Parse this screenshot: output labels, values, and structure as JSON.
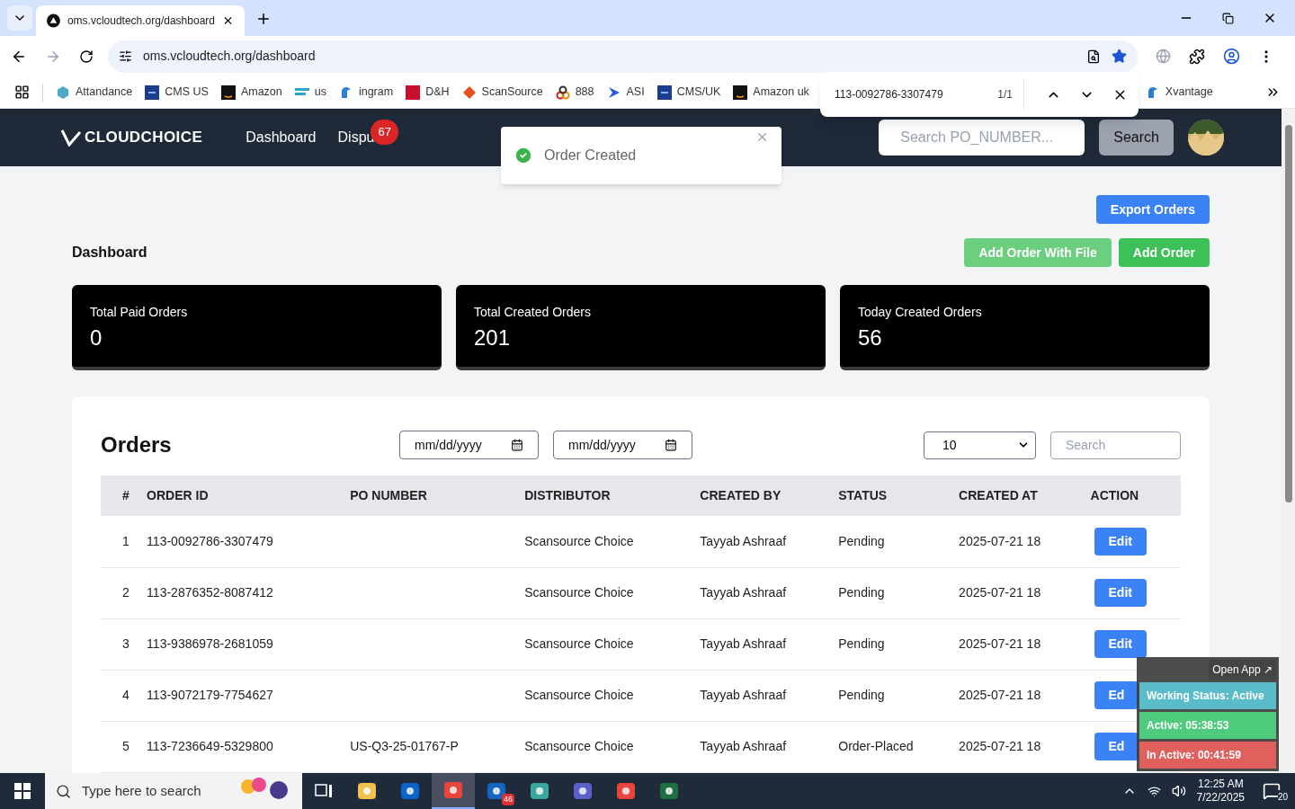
{
  "browser": {
    "tabs": [
      {
        "title": "oms.vcloudtech.org/dashboard",
        "selected": true
      }
    ],
    "address": "oms.vcloudtech.org/dashboard",
    "bookmarks": [
      {
        "label": "Attandance",
        "kind": "hex"
      },
      {
        "label": "CMS US",
        "kind": "df"
      },
      {
        "label": "Amazon",
        "kind": "amazon"
      },
      {
        "label": "us",
        "kind": "ec"
      },
      {
        "label": "ingram",
        "kind": "bird"
      },
      {
        "label": "D&H",
        "kind": "dh"
      },
      {
        "label": "ScanSource",
        "kind": "scan"
      },
      {
        "label": "888",
        "kind": "rings"
      },
      {
        "label": "ASI",
        "kind": "arrow"
      },
      {
        "label": "CMS/UK",
        "kind": "df"
      },
      {
        "label": "Amazon uk",
        "kind": "amazon"
      },
      {
        "label": "Xvantage",
        "kind": "bird"
      }
    ],
    "find_bar": {
      "query": "113-0092786-3307479",
      "count": "1/1"
    }
  },
  "app": {
    "logo": "CLOUDCHOICE",
    "nav": [
      {
        "label": "Dashboard"
      },
      {
        "label": "Dispu",
        "badge": "67"
      }
    ],
    "toast": {
      "message": "Order Created"
    },
    "search": {
      "placeholder": "Search PO_NUMBER...",
      "button": "Search"
    },
    "page_title": "Dashboard",
    "buttons": [
      {
        "label": "Export Orders",
        "kind": "export"
      },
      {
        "label": "Add Order With File",
        "kind": "light"
      },
      {
        "label": "Add Order",
        "kind": "green"
      }
    ],
    "stats": [
      {
        "label": "Total Paid Orders",
        "value": "0"
      },
      {
        "label": "Total Created Orders",
        "value": "201"
      },
      {
        "label": "Today Created Orders",
        "value": "56"
      }
    ],
    "orders": {
      "title": "Orders",
      "date_from": "mm/dd/yyyy",
      "date_to": "mm/dd/yyyy",
      "page_size": "10",
      "search_placeholder": "Search",
      "columns": [
        "#",
        "ORDER ID",
        "PO NUMBER",
        "DISTRIBUTOR",
        "CREATED BY",
        "STATUS",
        "CREATED AT",
        "ACTION"
      ],
      "rows": [
        {
          "n": "1",
          "order_id": "113-0092786-3307479",
          "distributor": "Scansource Choice",
          "created_by": "Tayyab Ashraaf",
          "status": "Pending",
          "created_at": "2025-07-21 18",
          "action": "Edit"
        },
        {
          "n": "2",
          "order_id": "113-2876352-8087412",
          "distributor": "Scansource Choice",
          "created_by": "Tayyab Ashraaf",
          "status": "Pending",
          "created_at": "2025-07-21 18",
          "action": "Edit"
        },
        {
          "n": "3",
          "order_id": "113-9386978-2681059",
          "distributor": "Scansource Choice",
          "created_by": "Tayyab Ashraaf",
          "status": "Pending",
          "created_at": "2025-07-21 18",
          "action": "Edit"
        },
        {
          "n": "4",
          "order_id": "113-9072179-7754627",
          "distributor": "Scansource Choice",
          "created_by": "Tayyab Ashraaf",
          "status": "Pending",
          "created_at": "2025-07-21 18",
          "action": "Ed"
        },
        {
          "n": "5",
          "order_id": "113-7236649-5329800",
          "po": "US-Q3-25-01767-P",
          "distributor": "Scansource Choice",
          "created_by": "Tayyab Ashraaf",
          "status": "Order-Placed",
          "created_at": "2025-07-21 18",
          "action": "Ed"
        }
      ]
    }
  },
  "tracker": {
    "open_app": "Open App ↗",
    "lines": [
      {
        "text": "Working Status: Active",
        "color": "#5bbcc9"
      },
      {
        "text": "Active: 05:38:53",
        "color": "#4fcb7d"
      },
      {
        "text": "In Active: 00:41:59",
        "color": "#e0605e"
      }
    ]
  },
  "taskbar": {
    "search_placeholder": "Type here to search",
    "apps": [
      {
        "kind": "folder",
        "selected": false
      },
      {
        "kind": "outlook",
        "selected": false
      },
      {
        "kind": "chrome",
        "selected": true
      },
      {
        "kind": "zoho",
        "badge": "46",
        "selected": false
      },
      {
        "kind": "gem",
        "selected": false
      },
      {
        "kind": "teams",
        "selected": false
      },
      {
        "kind": "chrome",
        "selected": false
      },
      {
        "kind": "excel",
        "selected": false
      }
    ],
    "time": "12:25 AM",
    "date": "7/22/2025",
    "notifications": "20"
  }
}
